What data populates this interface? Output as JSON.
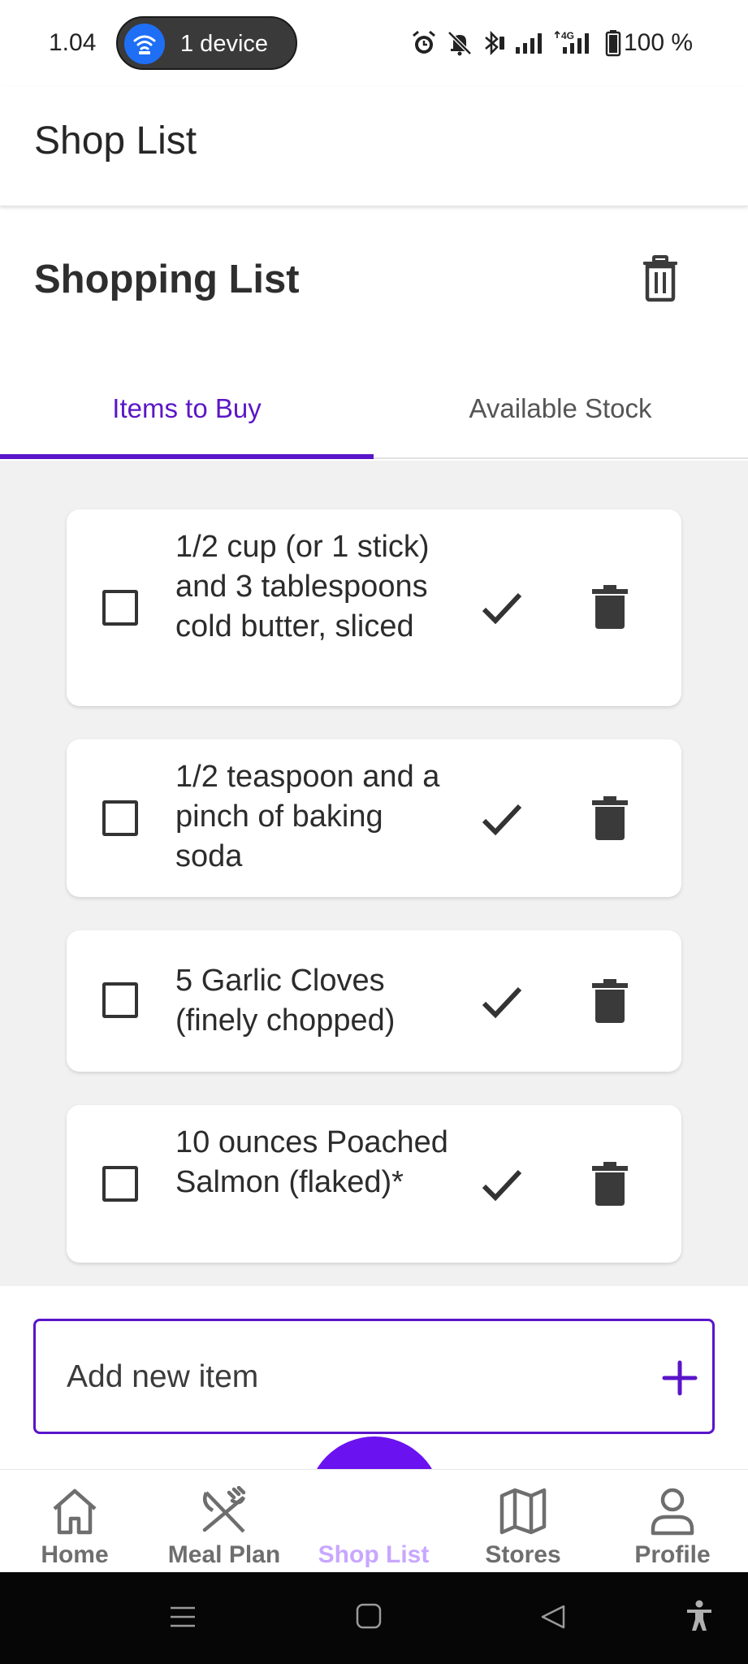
{
  "status_bar": {
    "time": "1.04",
    "hotspot_label": "1 device",
    "battery": "100 %",
    "icons": [
      "wifi-hotspot-icon",
      "alarm-icon",
      "mute-icon",
      "bluetooth-icon",
      "signal-icon",
      "lte-signal-icon",
      "battery-icon"
    ]
  },
  "app_bar": {
    "title": "Shop List"
  },
  "section": {
    "title": "Shopping List",
    "clear_icon": "trash-icon"
  },
  "tabs": [
    {
      "label": "Items to Buy",
      "selected": true
    },
    {
      "label": "Available Stock",
      "selected": false
    }
  ],
  "items": [
    {
      "text": "1/2 cup (or 1 stick) and 3 tablespoons cold butter, sliced",
      "checked": false
    },
    {
      "text": "1/2 teaspoon and a pinch of baking soda",
      "checked": false
    },
    {
      "text": "5 Garlic Cloves (finely chopped)",
      "checked": false
    },
    {
      "text": "10 ounces Poached Salmon (flaked)*",
      "checked": false
    }
  ],
  "add_item": {
    "placeholder": "Add new item",
    "icon": "plus-icon"
  },
  "bottom_nav": [
    {
      "label": "Home",
      "icon": "home-icon"
    },
    {
      "label": "Meal Plan",
      "icon": "utensils-icon"
    },
    {
      "label": "Shop List",
      "icon": "list-icon",
      "active": true
    },
    {
      "label": "Stores",
      "icon": "map-icon"
    },
    {
      "label": "Profile",
      "icon": "person-icon"
    }
  ],
  "colors": {
    "accent": "#5a14c9",
    "active_nav": "#6a12f0",
    "list_bg": "#f1f1f1"
  }
}
